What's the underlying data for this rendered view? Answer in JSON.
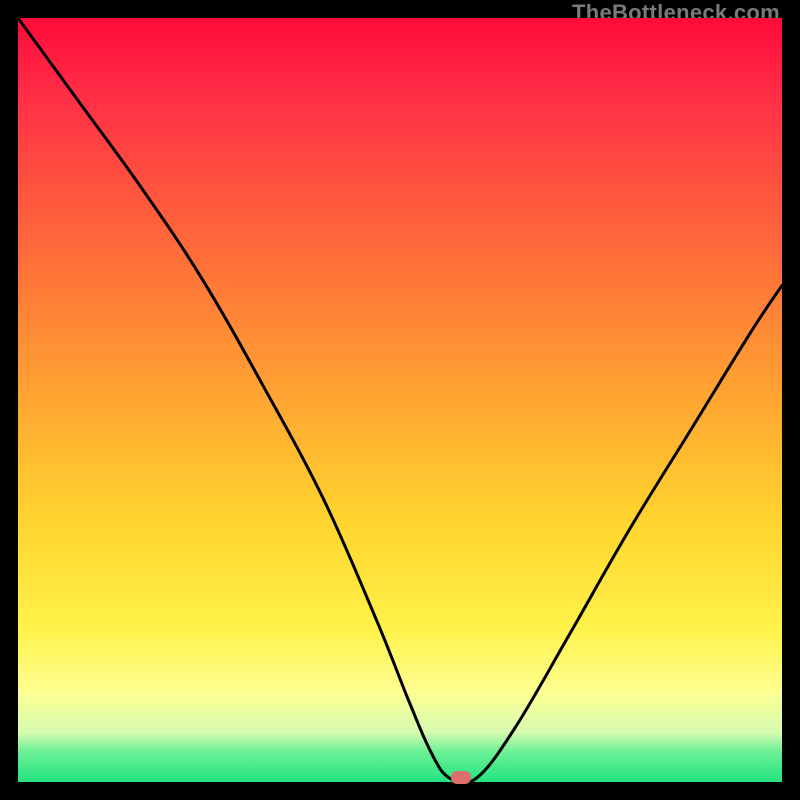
{
  "watermark": "TheBottleneck.com",
  "colors": {
    "frame": "#000000",
    "curve": "#000000",
    "marker": "#dc6e6b",
    "gradient_top": "#ff0a3a",
    "gradient_bottom": "#23e37f"
  },
  "chart_data": {
    "type": "line",
    "title": "",
    "xlabel": "",
    "ylabel": "",
    "xlim": [
      0,
      100
    ],
    "ylim": [
      0,
      100
    ],
    "series": [
      {
        "name": "bottleneck-curve",
        "x": [
          0,
          8,
          16,
          24,
          32,
          40,
          47,
          51,
          54,
          56.5,
          60,
          65,
          72,
          80,
          88,
          96,
          100
        ],
        "values": [
          100,
          89,
          78,
          66,
          52,
          37,
          21,
          11,
          4,
          0.5,
          0.5,
          7,
          19,
          33,
          46,
          59,
          65
        ]
      }
    ],
    "marker": {
      "x": 58,
      "y": 0.5
    },
    "annotations": []
  }
}
